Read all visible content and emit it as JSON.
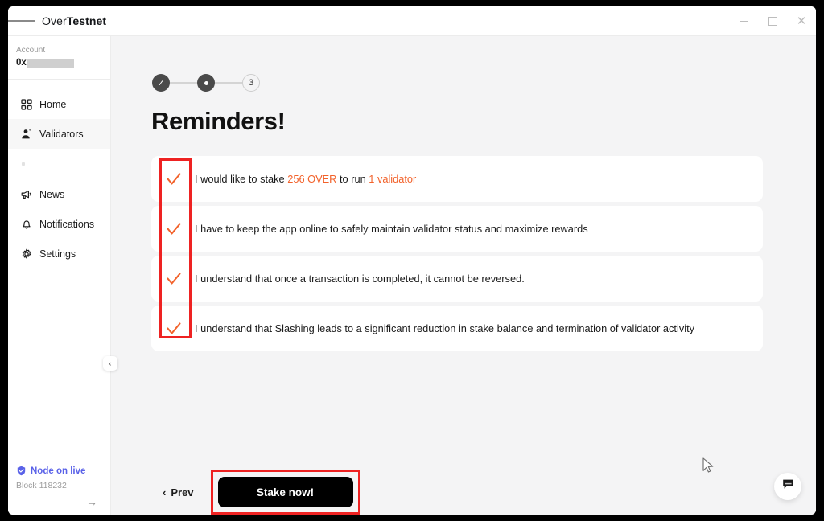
{
  "window": {
    "title_light": "Over",
    "title_bold": "Testnet",
    "menu_icon": "hamburger-icon",
    "minimize_label": "–",
    "maximize_label": "□",
    "close_label": "×"
  },
  "sidebar": {
    "account_label": "Account",
    "account_prefix": "0x",
    "items": [
      {
        "label": "Home",
        "icon": "grid-icon",
        "active": false
      },
      {
        "label": "Validators",
        "icon": "validator-person-icon",
        "active": true
      },
      {
        "label": "News",
        "icon": "megaphone-icon",
        "active": false
      },
      {
        "label": "Notifications",
        "icon": "bell-icon",
        "active": false
      },
      {
        "label": "Settings",
        "icon": "gear-icon",
        "active": false
      }
    ],
    "node_status": "Node on live",
    "block_label": "Block 118232",
    "arrow_label": "→",
    "collapse_label": "‹"
  },
  "stepper": {
    "step1_label": "✓",
    "step2_label": "",
    "step3_label": "3"
  },
  "main": {
    "page_title": "Reminders!",
    "reminders": [
      {
        "parts": [
          {
            "text": "I would like to stake ",
            "highlight": false
          },
          {
            "text": "256 OVER",
            "highlight": true
          },
          {
            "text": " to run ",
            "highlight": false
          },
          {
            "text": "1 validator",
            "highlight": true
          }
        ],
        "checked": true
      },
      {
        "parts": [
          {
            "text": "I have to keep the app online to safely maintain validator status and maximize rewards",
            "highlight": false
          }
        ],
        "checked": true
      },
      {
        "parts": [
          {
            "text": "I understand that once a transaction is completed, it cannot be reversed.",
            "highlight": false
          }
        ],
        "checked": true
      },
      {
        "parts": [
          {
            "text": "I understand that Slashing leads to a significant reduction in stake balance and termination of validator activity",
            "highlight": false
          }
        ],
        "checked": true
      }
    ],
    "prev_label": "Prev",
    "prev_chevron": "‹",
    "stake_label": "Stake now!"
  },
  "colors": {
    "accent_orange": "#f2622b",
    "annotation_red": "#ee2222",
    "node_blue": "#5a62e8",
    "primary_black": "#000000",
    "canvas": "#f4f4f5"
  }
}
